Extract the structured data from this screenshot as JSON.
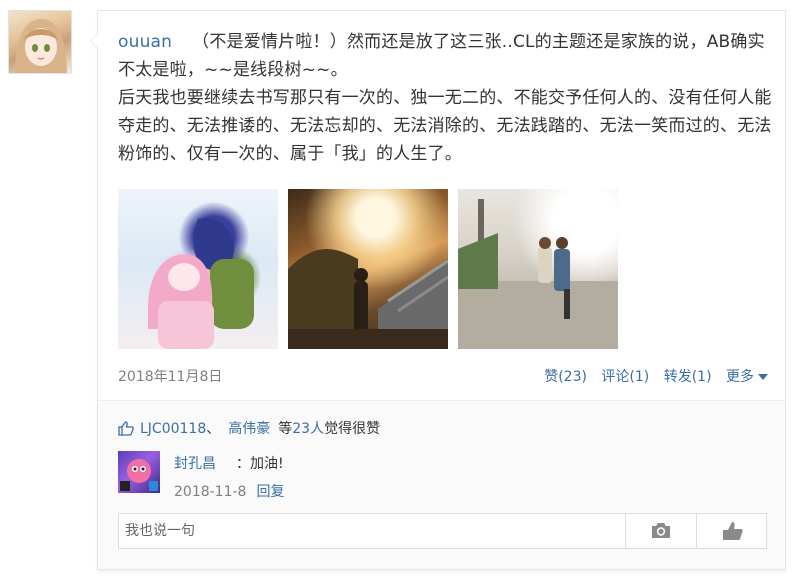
{
  "post": {
    "author": "ouuan",
    "line1": "（不是爱情片啦！）然而还是放了这三张..CL的主题还是家族的说，AB确实不太是啦，~~是线段树~~。",
    "line2": "后天我也要继续去书写那只有一次的、独一无二的、不能交予任何人的、没有任何人能夺走的、无法推诿的、无法忘却的、无法消除的、无法践踏的、无法一笑而过的、无法粉饰的、仅有一次的、属于「我」的人生了。",
    "date": "2018年11月8日",
    "actions": {
      "like": "赞(23)",
      "comment": "评论(1)",
      "repost": "转发(1)",
      "more": "更多"
    }
  },
  "likes": {
    "user1": "LJC00118",
    "sep": "、",
    "user2": "高伟豪",
    "prefix": "等",
    "count": "23人",
    "suffix": "觉得很赞"
  },
  "comment": {
    "user": "封孔昌",
    "text": "：加油!",
    "date": "2018-11-8",
    "reply": "回复"
  },
  "input": {
    "placeholder": "我也说一句"
  },
  "colors": {
    "link": "#3a6ea5",
    "muted": "#808080"
  }
}
